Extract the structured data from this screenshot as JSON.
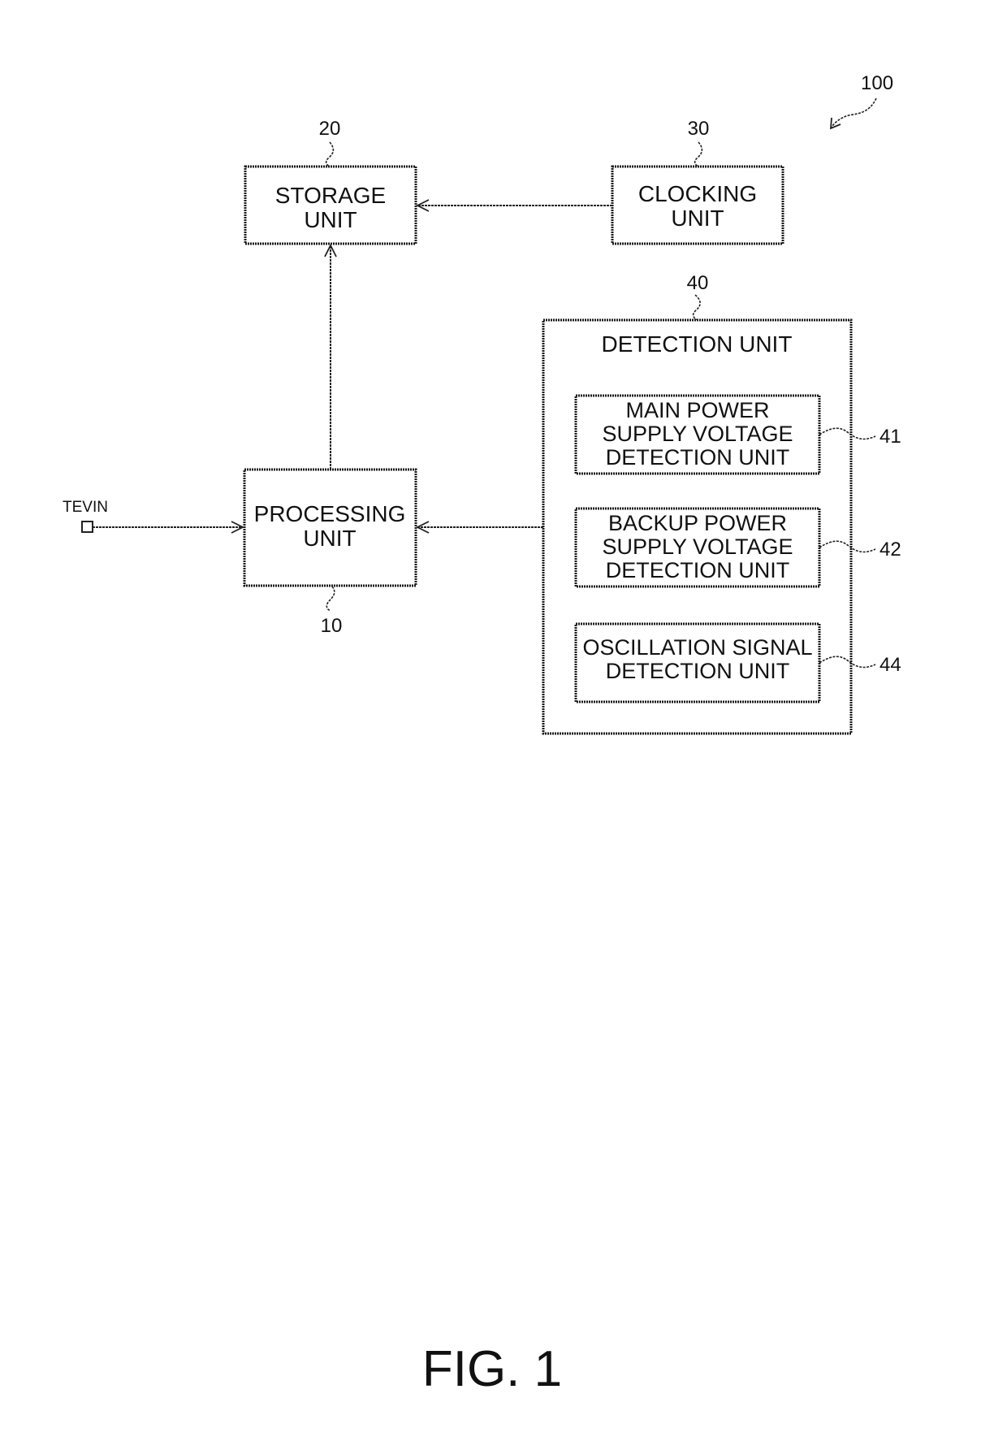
{
  "figure": {
    "system_ref": "100",
    "caption": "FIG. 1"
  },
  "blocks": {
    "storage": {
      "ref": "20",
      "lines": [
        "STORAGE",
        "UNIT"
      ]
    },
    "clocking": {
      "ref": "30",
      "lines": [
        "CLOCKING",
        "UNIT"
      ]
    },
    "processing": {
      "ref": "10",
      "lines": [
        "PROCESSING",
        "UNIT"
      ]
    },
    "detection": {
      "ref": "40",
      "title": "DETECTION UNIT",
      "sub_units": [
        {
          "ref": "41",
          "lines": [
            "MAIN POWER",
            "SUPPLY VOLTAGE",
            "DETECTION UNIT"
          ]
        },
        {
          "ref": "42",
          "lines": [
            "BACKUP POWER",
            "SUPPLY VOLTAGE",
            "DETECTION UNIT"
          ]
        },
        {
          "ref": "44",
          "lines": [
            "OSCILLATION SIGNAL",
            "DETECTION UNIT"
          ]
        }
      ]
    }
  },
  "terminal": {
    "label": "TEVIN"
  },
  "connections": [
    {
      "from": "clocking",
      "to": "storage"
    },
    {
      "from": "processing",
      "to": "storage"
    },
    {
      "from": "terminal",
      "to": "processing"
    },
    {
      "from": "detection",
      "to": "processing"
    }
  ]
}
